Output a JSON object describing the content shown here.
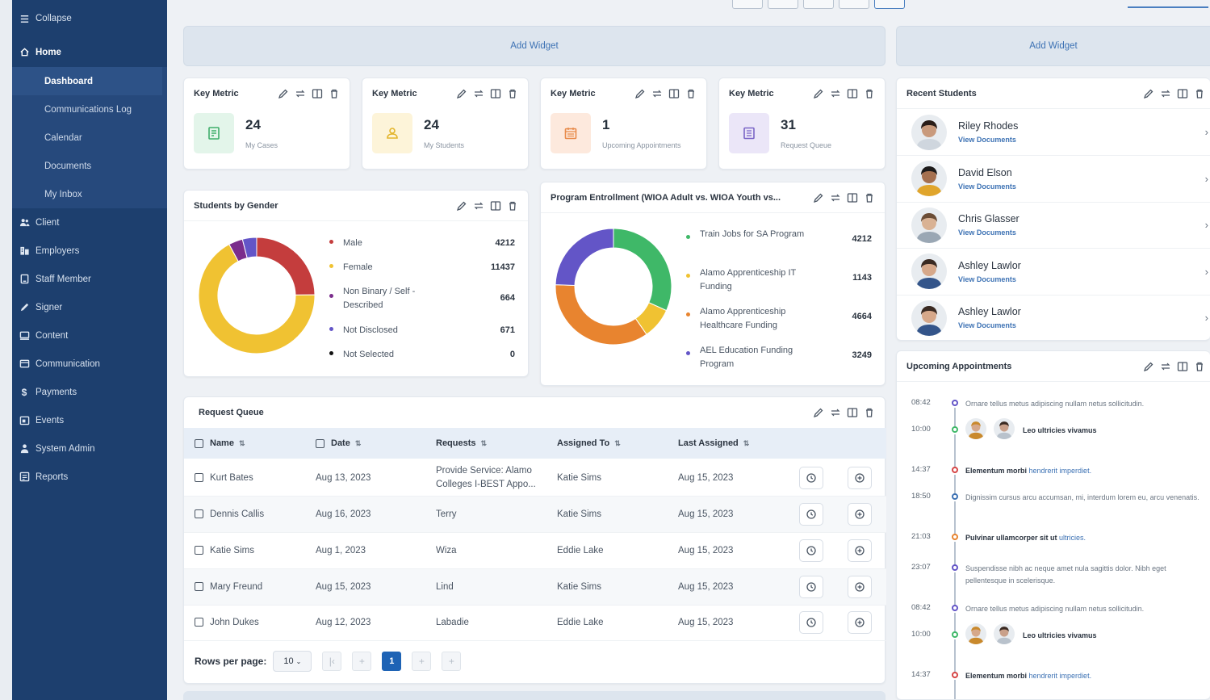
{
  "sidebar": {
    "collapse_label": "Collapse",
    "home_label": "Home",
    "home_items": [
      "Dashboard",
      "Communications Log",
      "Calendar",
      "Documents",
      "My Inbox"
    ],
    "items": [
      {
        "label": "Client",
        "icon": "client-icon"
      },
      {
        "label": "Employers",
        "icon": "employers-icon"
      },
      {
        "label": "Staff Member",
        "icon": "staff-member-icon"
      },
      {
        "label": "Signer",
        "icon": "signer-icon"
      },
      {
        "label": "Content",
        "icon": "content-icon"
      },
      {
        "label": "Communication",
        "icon": "communication-icon"
      },
      {
        "label": "Payments",
        "icon": "payments-icon"
      },
      {
        "label": "Events",
        "icon": "events-icon"
      },
      {
        "label": "System Admin",
        "icon": "system-admin-icon"
      },
      {
        "label": "Reports",
        "icon": "reports-icon"
      }
    ],
    "colors": {
      "background": "#1d3f6e",
      "active": "#2d5287"
    }
  },
  "add_widget_label": "Add Widget",
  "metrics": [
    {
      "title": "Key Metric",
      "value": "24",
      "label": "My Cases",
      "icon": "cases-icon",
      "bg": "#e3f5ea",
      "fg": "#3fae6a"
    },
    {
      "title": "Key Metric",
      "value": "24",
      "label": "My Students",
      "icon": "students-icon",
      "bg": "#fdf4d9",
      "fg": "#e3b52c"
    },
    {
      "title": "Key Metric",
      "value": "1",
      "label": "Upcoming Appointments",
      "icon": "calendar-icon",
      "bg": "#fde9dd",
      "fg": "#e88a4a"
    },
    {
      "title": "Key Metric",
      "value": "31",
      "label": "Request Queue",
      "icon": "queue-icon",
      "bg": "#ebe6f8",
      "fg": "#7a64c6"
    }
  ],
  "gender_chart": {
    "title": "Students by Gender",
    "legend": [
      {
        "label": "Male",
        "value": "4212",
        "color": "#c43d3d"
      },
      {
        "label": "Female",
        "value": "11437",
        "color": "#f0c232"
      },
      {
        "label": "Non Binary / Self - Described",
        "value": "664",
        "color": "#7b2d8c"
      },
      {
        "label": "Not Disclosed",
        "value": "671",
        "color": "#6355c7"
      },
      {
        "label": "Not Selected",
        "value": "0",
        "color": "#111111"
      }
    ]
  },
  "program_chart": {
    "title": "Program Entrollment (WIOA Adult vs. WIOA Youth vs...",
    "legend": [
      {
        "label": "Train Jobs for SA Program",
        "value": "4212",
        "color": "#3fb868"
      },
      {
        "label": "Alamo Apprenticeship IT Funding",
        "value": "1143",
        "color": "#f0c232"
      },
      {
        "label": "Alamo Apprenticeship Healthcare Funding",
        "value": "4664",
        "color": "#e8842f"
      },
      {
        "label": "AEL Education Funding Program",
        "value": "3249",
        "color": "#6355c7"
      }
    ]
  },
  "chart_data": [
    {
      "type": "pie",
      "title": "Students by Gender",
      "categories": [
        "Male",
        "Female",
        "Non Binary / Self - Described",
        "Not Disclosed",
        "Not Selected"
      ],
      "values": [
        4212,
        11437,
        664,
        671,
        0
      ]
    },
    {
      "type": "pie",
      "title": "Program Entrollment (WIOA Adult vs. WIOA Youth vs...",
      "categories": [
        "Train Jobs for SA Program",
        "Alamo Apprenticeship IT Funding",
        "Alamo Apprenticeship Healthcare Funding",
        "AEL Education Funding Program"
      ],
      "values": [
        4212,
        1143,
        4664,
        3249
      ]
    }
  ],
  "request_queue": {
    "title": "Request Queue",
    "columns": [
      "Name",
      "Date",
      "Requests",
      "Assigned To",
      "Last Assigned"
    ],
    "rows": [
      {
        "name": "Kurt Bates",
        "date": "Aug 13, 2023",
        "request": "Provide Service: Alamo Colleges I-BEST Appo...",
        "assigned": "Katie Sims",
        "last": "Aug 15, 2023"
      },
      {
        "name": "Dennis Callis",
        "date": "Aug 16, 2023",
        "request": "Terry",
        "assigned": "Katie Sims",
        "last": "Aug 15, 2023"
      },
      {
        "name": "Katie Sims",
        "date": "Aug 1, 2023",
        "request": "Wiza",
        "assigned": "Eddie Lake",
        "last": "Aug 15, 2023"
      },
      {
        "name": "Mary Freund",
        "date": "Aug 15, 2023",
        "request": "Lind",
        "assigned": "Katie Sims",
        "last": "Aug 15, 2023"
      },
      {
        "name": "John Dukes",
        "date": "Aug 12, 2023",
        "request": "Labadie",
        "assigned": "Eddie Lake",
        "last": "Aug 15, 2023"
      }
    ],
    "rows_per_page_label": "Rows per page:",
    "rows_per_page_value": "10",
    "current_page": "1"
  },
  "recent_students": {
    "title": "Recent Students",
    "link_label": "View Documents",
    "students": [
      {
        "name": "Riley Rhodes",
        "skin": "#c99a7c",
        "hair": "#2a1d18",
        "shirt": "#cfd6de"
      },
      {
        "name": "David Elson",
        "skin": "#a5704f",
        "hair": "#1c1a1a",
        "shirt": "#e0a52c"
      },
      {
        "name": "Chris Glasser",
        "skin": "#d9b294",
        "hair": "#6b4d36",
        "shirt": "#9aa7b4"
      },
      {
        "name": "Ashley Lawlor",
        "skin": "#d6a88a",
        "hair": "#3a2a22",
        "shirt": "#34558a"
      },
      {
        "name": "Ashley Lawlor",
        "skin": "#d6a88a",
        "hair": "#3a2a22",
        "shirt": "#34558a"
      }
    ]
  },
  "appointments": {
    "title": "Upcoming Appointments",
    "items": [
      {
        "time": "08:42",
        "color": "#6355c7",
        "text": "Ornare tellus metus adipiscing nullam netus sollicitudin."
      },
      {
        "time": "10:00",
        "color": "#3fb868",
        "bold": "Leo ultricies vivamus",
        "avatars": true
      },
      {
        "time": "14:37",
        "color": "#d64545",
        "bold": "Elementum morbi",
        "link": "hendrerit imperdiet."
      },
      {
        "time": "18:50",
        "color": "#3d72b4",
        "text": "Dignissim cursus arcu accumsan, mi, interdum lorem eu, arcu venenatis."
      },
      {
        "time": "21:03",
        "color": "#e8842f",
        "bold": "Pulvinar ullamcorper sit ut",
        "link": "ultricies."
      },
      {
        "time": "23:07",
        "color": "#6355c7",
        "text": "Suspendisse nibh ac neque amet nula sagittis dolor. Nibh eget pellentesque in scelerisque."
      },
      {
        "time": "08:42",
        "color": "#6355c7",
        "text": "Ornare tellus metus adipiscing nullam netus sollicitudin."
      },
      {
        "time": "10:00",
        "color": "#3fb868",
        "bold": "Leo ultricies vivamus",
        "avatars": true
      },
      {
        "time": "14:37",
        "color": "#d64545",
        "bold": "Elementum morbi",
        "link": "hendrerit imperdiet."
      }
    ]
  }
}
